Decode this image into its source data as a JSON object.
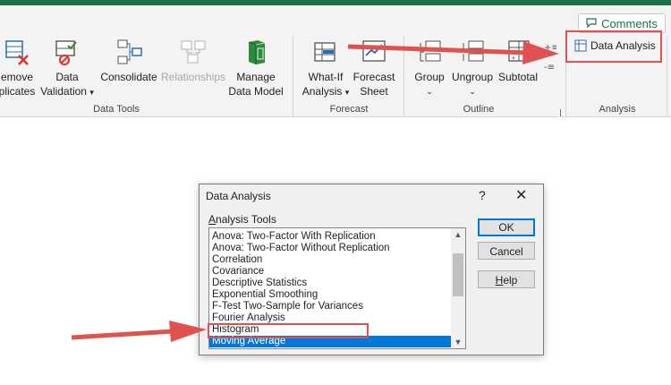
{
  "ribbon": {
    "comments_label": "Comments",
    "buttons": [
      {
        "l1": "emove",
        "l2": "plicates"
      },
      {
        "l1": "Data",
        "l2": "Validation"
      },
      {
        "l1": "Consolidate",
        "l2": ""
      },
      {
        "l1": "Relationships",
        "l2": ""
      },
      {
        "l1": "Manage",
        "l2": "Data Model"
      },
      {
        "l1": "What-If",
        "l2": "Analysis"
      },
      {
        "l1": "Forecast",
        "l2": "Sheet"
      },
      {
        "l1": "Group",
        "l2": ""
      },
      {
        "l1": "Ungroup",
        "l2": ""
      },
      {
        "l1": "Subtotal",
        "l2": ""
      }
    ],
    "groups": {
      "data_tools": "Data Tools",
      "forecast": "Forecast",
      "outline": "Outline",
      "analysis": "Analysis"
    },
    "data_analysis_label": "Data Analysis"
  },
  "dialog": {
    "title": "Data Analysis",
    "help_glyph": "?",
    "close_glyph": "✕",
    "list_label": "Analysis Tools",
    "items": [
      "Anova: Two-Factor With Replication",
      "Anova: Two-Factor Without Replication",
      "Correlation",
      "Covariance",
      "Descriptive Statistics",
      "Exponential Smoothing",
      "F-Test Two-Sample for Variances",
      "Fourier Analysis",
      "Histogram",
      "Moving Average"
    ],
    "ok": "OK",
    "cancel": "Cancel",
    "help": "Help"
  },
  "colors": {
    "accent": "#1e7145",
    "highlight": "#e05252",
    "selection": "#0078d7"
  }
}
